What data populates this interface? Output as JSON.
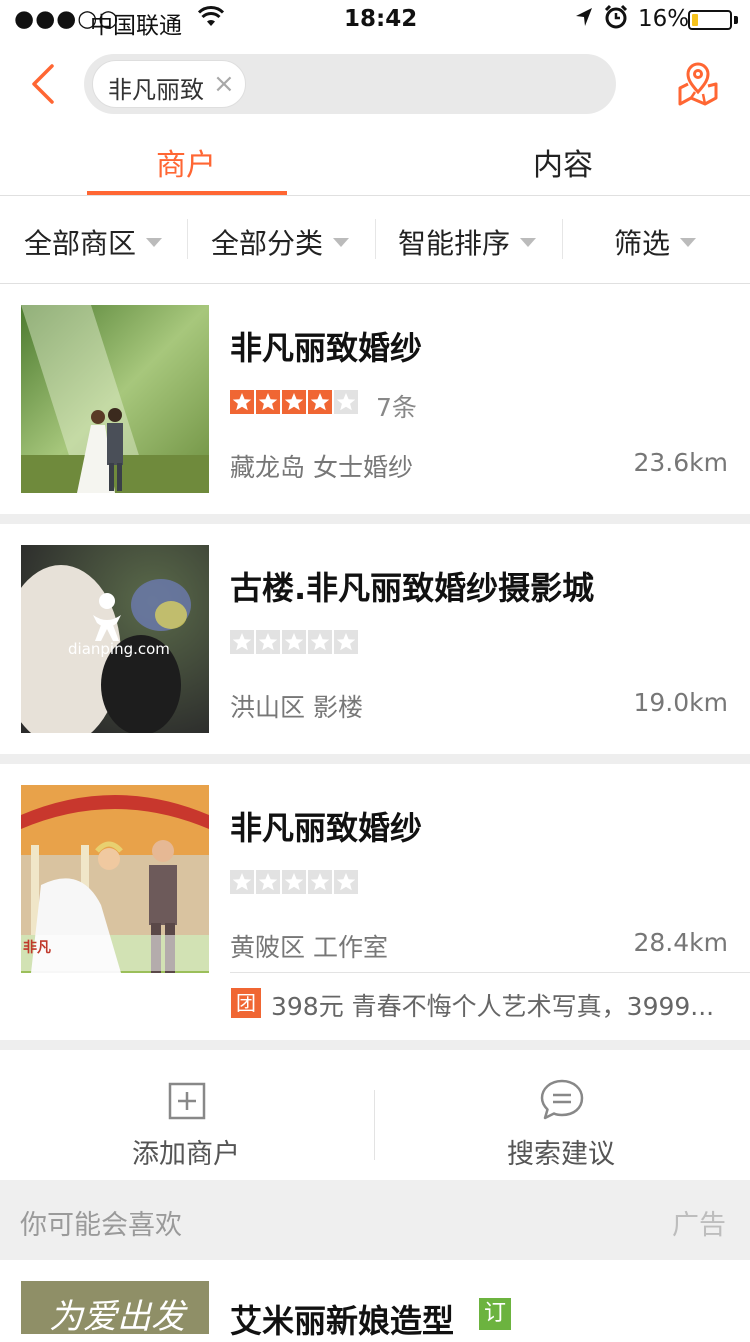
{
  "status_bar": {
    "signal": "●●●○○",
    "carrier": "中国联通",
    "time": "18:42",
    "battery_pct": "16%",
    "battery_level": 0.16
  },
  "header": {
    "search_tag": "非凡丽致",
    "clear_symbol": "×"
  },
  "tabs": [
    {
      "label": "商户",
      "active": true
    },
    {
      "label": "内容",
      "active": false
    }
  ],
  "filters": [
    "全部商区",
    "全部分类",
    "智能排序",
    "筛选"
  ],
  "listings": [
    {
      "name": "非凡丽致婚纱",
      "rating": 4,
      "reviews": "7条",
      "area": "藏龙岛 女士婚纱",
      "distance": "23.6km"
    },
    {
      "name": "古楼.非凡丽致婚纱摄影城",
      "rating": 0,
      "reviews": "",
      "area": "洪山区 影楼",
      "distance": "19.0km",
      "watermark": "dianping.com"
    },
    {
      "name": "非凡丽致婚纱",
      "rating": 0,
      "reviews": "",
      "area": "黄陂区 工作室",
      "distance": "28.4km",
      "deal": {
        "badge": "团",
        "text": "398元 青春不悔个人艺术写真，3999..."
      }
    }
  ],
  "actions": {
    "add_shop": "添加商户",
    "suggest": "搜索建议"
  },
  "recommend": {
    "title": "你可能会喜欢",
    "ad_label": "广告",
    "item_name": "艾米丽新娘造型",
    "item_badge": "订",
    "thumb_text": "为爱出发"
  },
  "colors": {
    "accent": "#ff6633",
    "star_on": "#f06633",
    "star_off": "#e2e2e2",
    "deal_badge": "#f06633",
    "book_badge": "#6cb33f"
  }
}
